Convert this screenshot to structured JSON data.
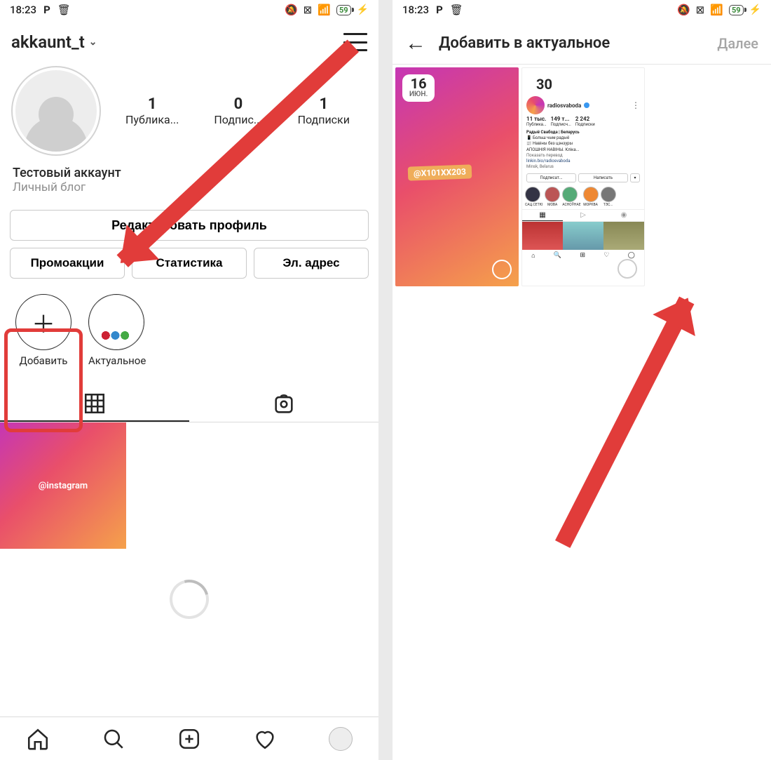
{
  "statusbar": {
    "time": "18:23",
    "p_icon": "P",
    "trash_icon": "🗑",
    "mute_icon": "🔕",
    "box_x": "⊠",
    "wifi": "📶",
    "battery_pct": "59",
    "bolt": "⚡"
  },
  "screen1": {
    "username": "akkaunt_t",
    "stats": [
      {
        "num": "1",
        "label": "Публика..."
      },
      {
        "num": "0",
        "label": "Подпис..."
      },
      {
        "num": "1",
        "label": "Подписки"
      }
    ],
    "bio_name": "Тестовый аккаунт",
    "bio_category": "Личный блог",
    "edit_button": "Редактировать профиль",
    "promo_button": "Промоакции",
    "stats_button": "Статистика",
    "email_button": "Эл. адрес",
    "highlight_add": "Добавить",
    "highlight_actual": "Актуальное",
    "post_tag": "@instagram"
  },
  "screen2": {
    "title": "Добавить в актуальное",
    "next": "Далее",
    "story1": {
      "day": "16",
      "month": "июн.",
      "mention": "@X101XX203"
    },
    "story2": {
      "day": "30",
      "username": "radiosvaboda",
      "stat_posts": "11 тыс.",
      "stat_followers": "149 т...",
      "stat_following": "2 242",
      "stat_posts_l": "Публика...",
      "stat_followers_l": "Подписч...",
      "stat_following_l": "Подписки",
      "bio_title": "Радыё Свабода | Беларусь",
      "bio_line1": "📱 Больш чым радыё",
      "bio_line2": "📰 Навіны без цэнзуры",
      "bio_line3": "АПОШНІЯ НАВІНЫ. Кліка...",
      "bio_translate": "Показать перевод",
      "bio_link": "linkin.bio/radiosvaboda",
      "bio_loc": "Minsk, Belarus",
      "btn_follow": "Подписат...",
      "btn_msg": "Написать",
      "btn_more": "▾",
      "hl": [
        "САЦ.СЕТКІ",
        "МОВА",
        "АСНОЎНАЕ",
        "МОРКВА",
        "ТЭС..."
      ]
    }
  }
}
